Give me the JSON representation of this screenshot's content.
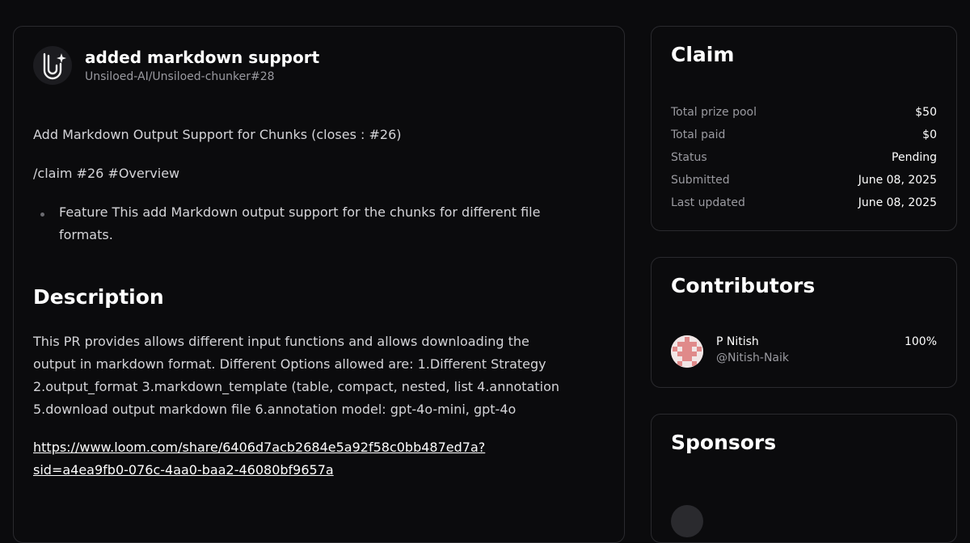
{
  "pr": {
    "title": "added markdown support",
    "reference": "Unsiloed-AI/Unsiloed-chunker#28",
    "paragraph1": "Add Markdown Output Support for Chunks (closes : #26)",
    "paragraph2": "/claim #26 #Overview",
    "bullet": "Feature This add Markdown output support for the chunks for different file formats.",
    "description_heading": "Description",
    "description": "This PR provides allows different input functions and allows downloading the output in markdown format. Different Options allowed are: 1.Different Strategy 2.output_format 3.markdown_template (table, compact, nested, list 4.annotation 5.download output markdown file 6.annotation model: gpt-4o-mini, gpt-4o",
    "link": "https://www.loom.com/share/6406d7acb2684e5a92f58c0bb487ed7a?sid=a4ea9fb0-076c-4aa0-baa2-46080bf9657a"
  },
  "claim": {
    "title": "Claim",
    "rows": [
      {
        "label": "Total prize pool",
        "value": "$50"
      },
      {
        "label": "Total paid",
        "value": "$0"
      },
      {
        "label": "Status",
        "value": "Pending"
      },
      {
        "label": "Submitted",
        "value": "June 08, 2025"
      },
      {
        "label": "Last updated",
        "value": "June 08, 2025"
      }
    ]
  },
  "contributors": {
    "title": "Contributors",
    "items": [
      {
        "name": "P Nitish",
        "handle": "@Nitish-Naik",
        "share": "100%"
      }
    ]
  },
  "sponsors": {
    "title": "Sponsors"
  },
  "icons": {
    "repo_logo": "unsiloed-logo-icon",
    "contributor_avatar": "identicon-avatar"
  },
  "colors": {
    "background": "#0b0b0d",
    "card_border": "#2a2a2e",
    "muted_text": "#9a9aa0",
    "avatar_pattern": "#e08a8a"
  }
}
